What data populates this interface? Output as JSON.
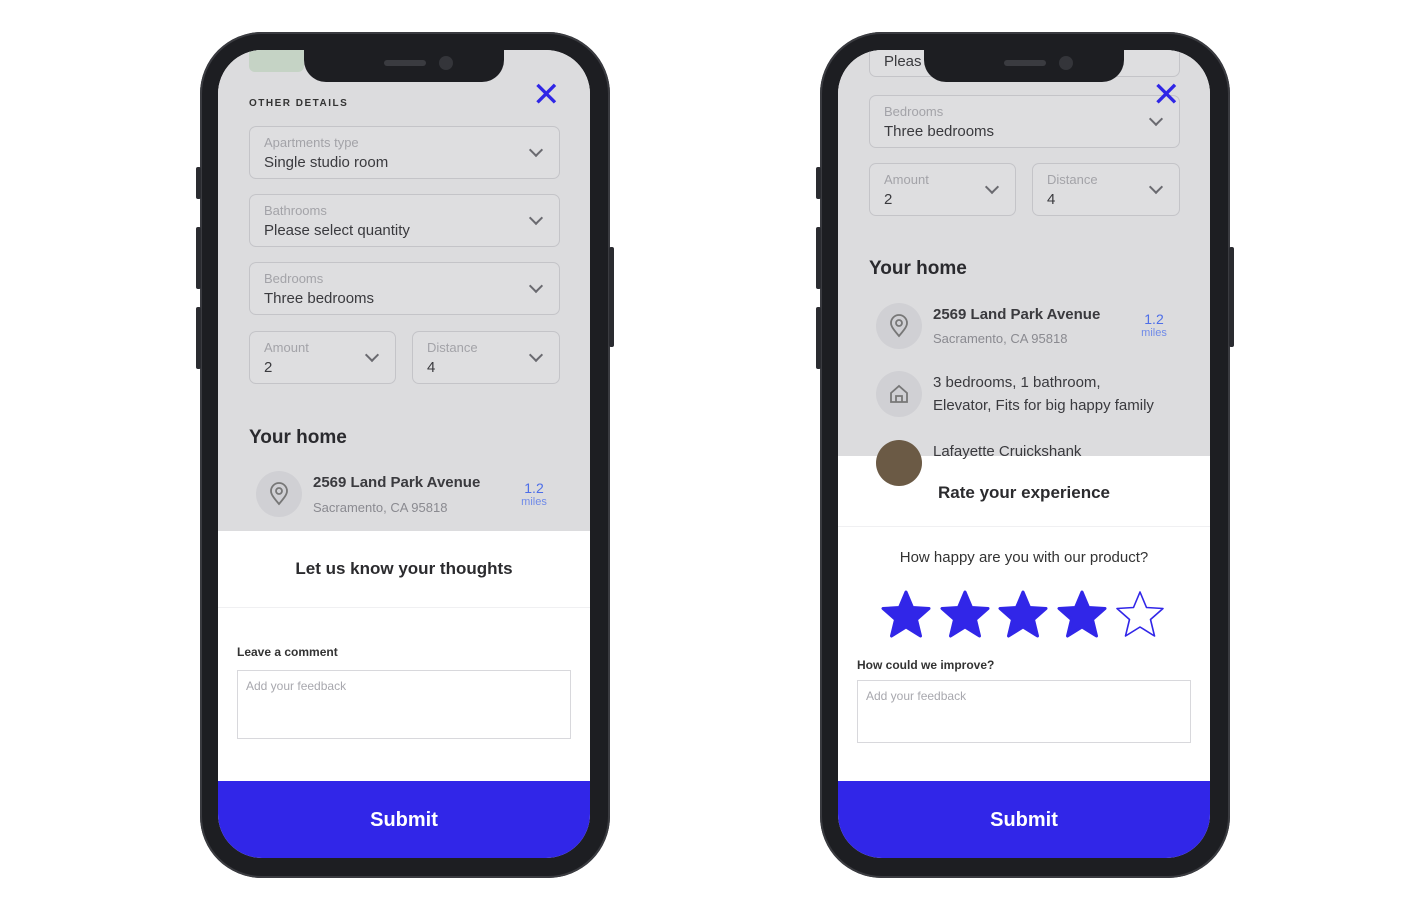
{
  "colors": {
    "accent": "#3126e8",
    "overlay": "#dcdcde"
  },
  "left_phone": {
    "section_title": "OTHER DETAILS",
    "close_icon": "close-icon",
    "fields": [
      {
        "label": "Apartments type",
        "value": "Single studio room"
      },
      {
        "label": "Bathrooms",
        "value": "Please select quantity"
      },
      {
        "label": "Bedrooms",
        "value": "Three bedrooms"
      },
      {
        "label": "Amount",
        "value": "2"
      },
      {
        "label": "Distance",
        "value": "4"
      }
    ],
    "your_home": "Your home",
    "address": {
      "line1": "2569 Land Park Avenue",
      "line2": "Sacramento, CA 95818",
      "distance": "1.2",
      "unit": "miles"
    },
    "sheet_title": "Let us know your thoughts",
    "comment_label": "Leave a comment",
    "comment_placeholder": "Add your feedback",
    "submit": "Submit"
  },
  "right_phone": {
    "partial_field_value": "Pleas",
    "fields": [
      {
        "label": "Bedrooms",
        "value": "Three bedrooms"
      },
      {
        "label": "Amount",
        "value": "2"
      },
      {
        "label": "Distance",
        "value": "4"
      }
    ],
    "your_home": "Your home",
    "address": {
      "line1": "2569 Land Park Avenue",
      "line2": "Sacramento, CA 95818",
      "distance": "1.2",
      "unit": "miles"
    },
    "details": {
      "line1": "3 bedrooms, 1 bathroom,",
      "line2": "Elevator, Fits for big happy family"
    },
    "owner": "Lafayette Cruickshank",
    "sheet_title": "Rate your experience",
    "question": "How happy are you with our product?",
    "rating": {
      "value": 4,
      "max": 5
    },
    "improve_label": "How could we improve?",
    "feedback_placeholder": "Add your feedback",
    "submit": "Submit"
  }
}
